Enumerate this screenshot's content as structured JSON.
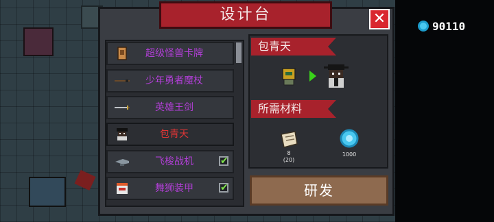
{
  "title": "设计台",
  "close_glyph": "✕",
  "currency": {
    "icon": "gem-icon",
    "amount": "90110"
  },
  "list": {
    "items": [
      {
        "label": "超级怪兽卡牌",
        "icon": "card-icon",
        "checked": false,
        "color": "#b13fd6"
      },
      {
        "label": "少年勇者魔杖",
        "icon": "wand-icon",
        "checked": false,
        "color": "#b13fd6"
      },
      {
        "label": "英雄王剑",
        "icon": "sword-icon",
        "checked": false,
        "color": "#b13fd6"
      },
      {
        "label": "包青天",
        "icon": "bao-skin-icon",
        "checked": false,
        "selected": true,
        "color": "#e03535"
      },
      {
        "label": "飞梭战机",
        "icon": "jet-icon",
        "checked": true,
        "color": "#b13fd6"
      },
      {
        "label": "舞狮装甲",
        "icon": "lion-armor-icon",
        "checked": true,
        "color": "#b13fd6"
      }
    ],
    "check_glyph": "✔"
  },
  "detail": {
    "name": "包青天",
    "materials_label": "所需材料",
    "materials": [
      {
        "icon": "blueprint-scroll-icon",
        "count": "8",
        "required": "(20)"
      },
      {
        "icon": "gem-icon",
        "count": "1000"
      }
    ]
  },
  "develop_button": "研发",
  "colors": {
    "accent_red": "#a8222c",
    "rare_purple": "#b13fd6",
    "selected_red": "#e03535",
    "check_green": "#7fe34a"
  }
}
